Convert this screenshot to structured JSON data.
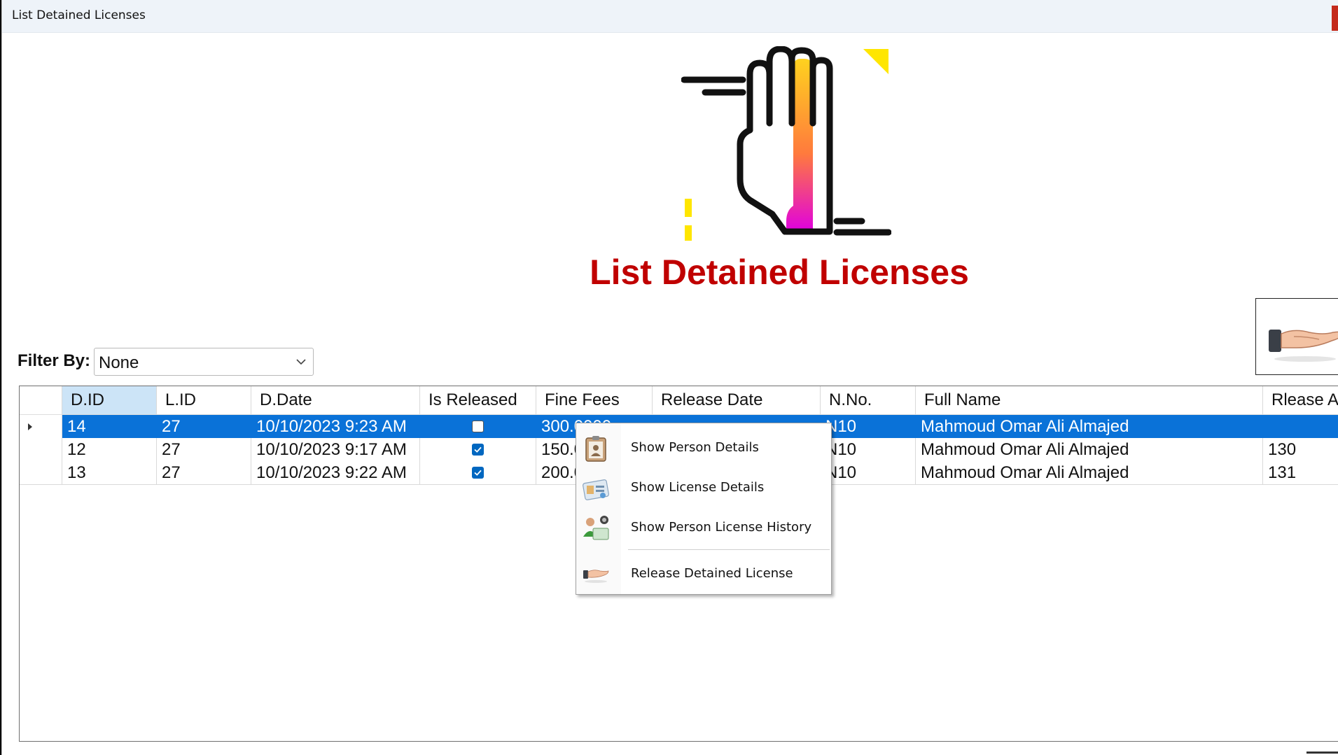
{
  "window": {
    "title": "List Detained Licenses"
  },
  "header": {
    "heading": "List Detained Licenses"
  },
  "filter": {
    "label": "Filter By:",
    "selected": "None"
  },
  "table": {
    "columns": [
      "D.ID",
      "L.ID",
      "D.Date",
      "Is Released",
      "Fine Fees",
      "Release Date",
      "N.No.",
      "Full Name",
      "Rlease Ap"
    ],
    "rows": [
      {
        "did": "14",
        "lid": "27",
        "ddate": "10/10/2023 9:23 AM",
        "released": false,
        "fees": "300.0000",
        "release_date": "",
        "nno": "N10",
        "name": "Mahmoud Omar Ali Almajed",
        "rapp": ""
      },
      {
        "did": "12",
        "lid": "27",
        "ddate": "10/10/2023 9:17 AM",
        "released": true,
        "fees": "150.0000",
        "release_date": "",
        "nno": "N10",
        "name": "Mahmoud Omar Ali Almajed",
        "rapp": "130"
      },
      {
        "did": "13",
        "lid": "27",
        "ddate": "10/10/2023 9:22 AM",
        "released": true,
        "fees": "200.0000",
        "release_date": "",
        "nno": "N10",
        "name": "Mahmoud Omar Ali Almajed",
        "rapp": "131"
      }
    ]
  },
  "context_menu": {
    "items": [
      {
        "label": "Show Person Details",
        "icon": "person-card-icon"
      },
      {
        "label": "Show License Details",
        "icon": "license-card-icon"
      },
      {
        "label": "Show Person License History",
        "icon": "person-history-icon"
      },
      {
        "label": "Release Detained License",
        "icon": "release-hand-icon"
      }
    ]
  },
  "colors": {
    "accent": "#0a72d8",
    "title_red": "#c00000",
    "select_header": "#cce4f7"
  }
}
